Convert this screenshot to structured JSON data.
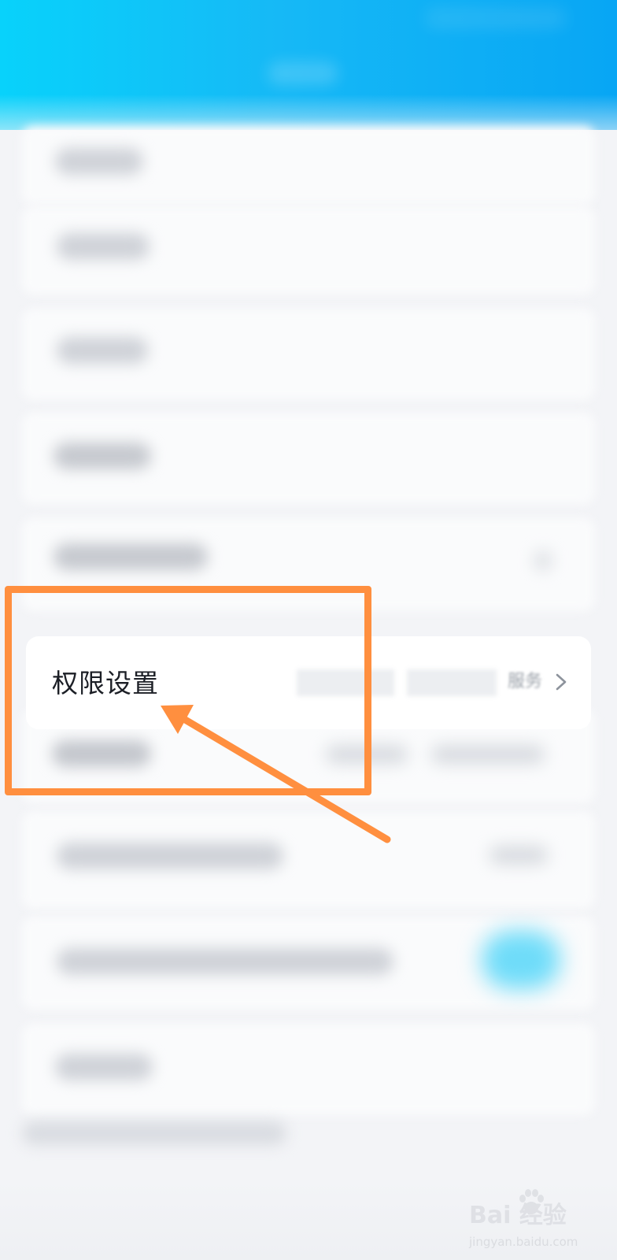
{
  "permission_row": {
    "label": "权限设置",
    "value_tail": "服务"
  },
  "watermark": {
    "main": "Bai  经验",
    "sub": "jingyan.baidu.com"
  },
  "colors": {
    "header_start": "#08d2fb",
    "header_end": "#08a6f4",
    "annotation": "#ff8f3f",
    "toggle": "#6fdcf9",
    "background": "#f3f4f7"
  },
  "icons": {
    "row_arrow": "chevron-right-icon",
    "annotation_pointer": "arrow-icon",
    "watermark_logo": "paw-icon"
  }
}
